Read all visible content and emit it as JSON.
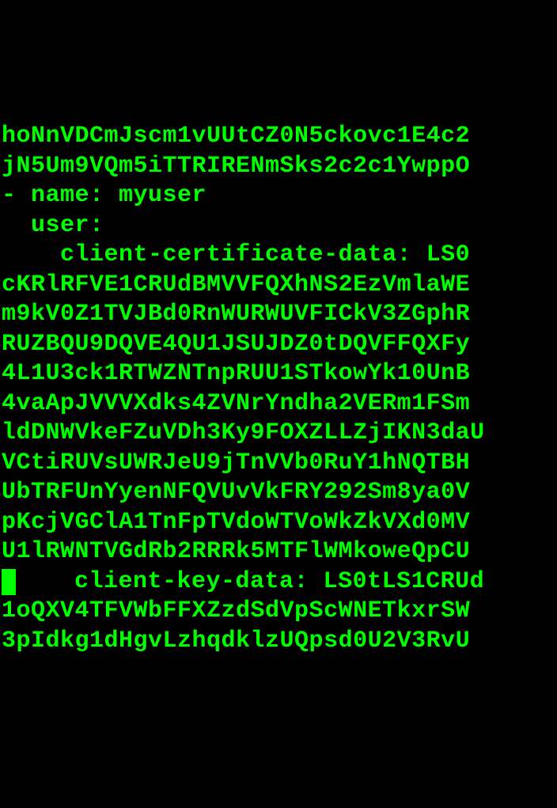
{
  "terminal": {
    "lines": [
      "hoNnVDCmJscm1vUUtCZ0N5ckovc1E4c2",
      "jN5Um9VQm5iTTRIRENmSks2c2c1YwppO",
      "- name: myuser",
      "  user:",
      "    client-certificate-data: LS0",
      "cKRlRFVE1CRUdBMVVFQXhNS2EzVmlaWE",
      "m9kV0Z1TVJBd0RnWURWUVFICkV3ZGphR",
      "RUZBQU9DQVE4QU1JSUJDZ0tDQVFFQXFy",
      "4L1U3ck1RTWZNTnpRUU1STkowYk10UnB",
      "4vaApJVVVXdks4ZVNrYndha2VERm1FSm",
      "ldDNWVkeFZuVDh3Ky9FOXZLLZjIKN3daU",
      "VCtiRUVsUWRJeU9jTnVVb0RuY1hNQTBH",
      "UbTRFUnYyenNFQVUvVkFRY292Sm8ya0V",
      "pKcjVGClA1TnFpTVdoWTVoWkZkVXd0MV",
      "U1lRWNTVGdRb2RRRk5MTFlWMkoweQpCU",
      "    client-key-data: LS0tLS1CRUd",
      "1oQXV4TFVWbFFXZzdSdVpScWNETkxrSW",
      "3pIdkg1dHgvLzhqdklzUQpsd0U2V3RvU"
    ],
    "cursor_line_index": 15
  }
}
